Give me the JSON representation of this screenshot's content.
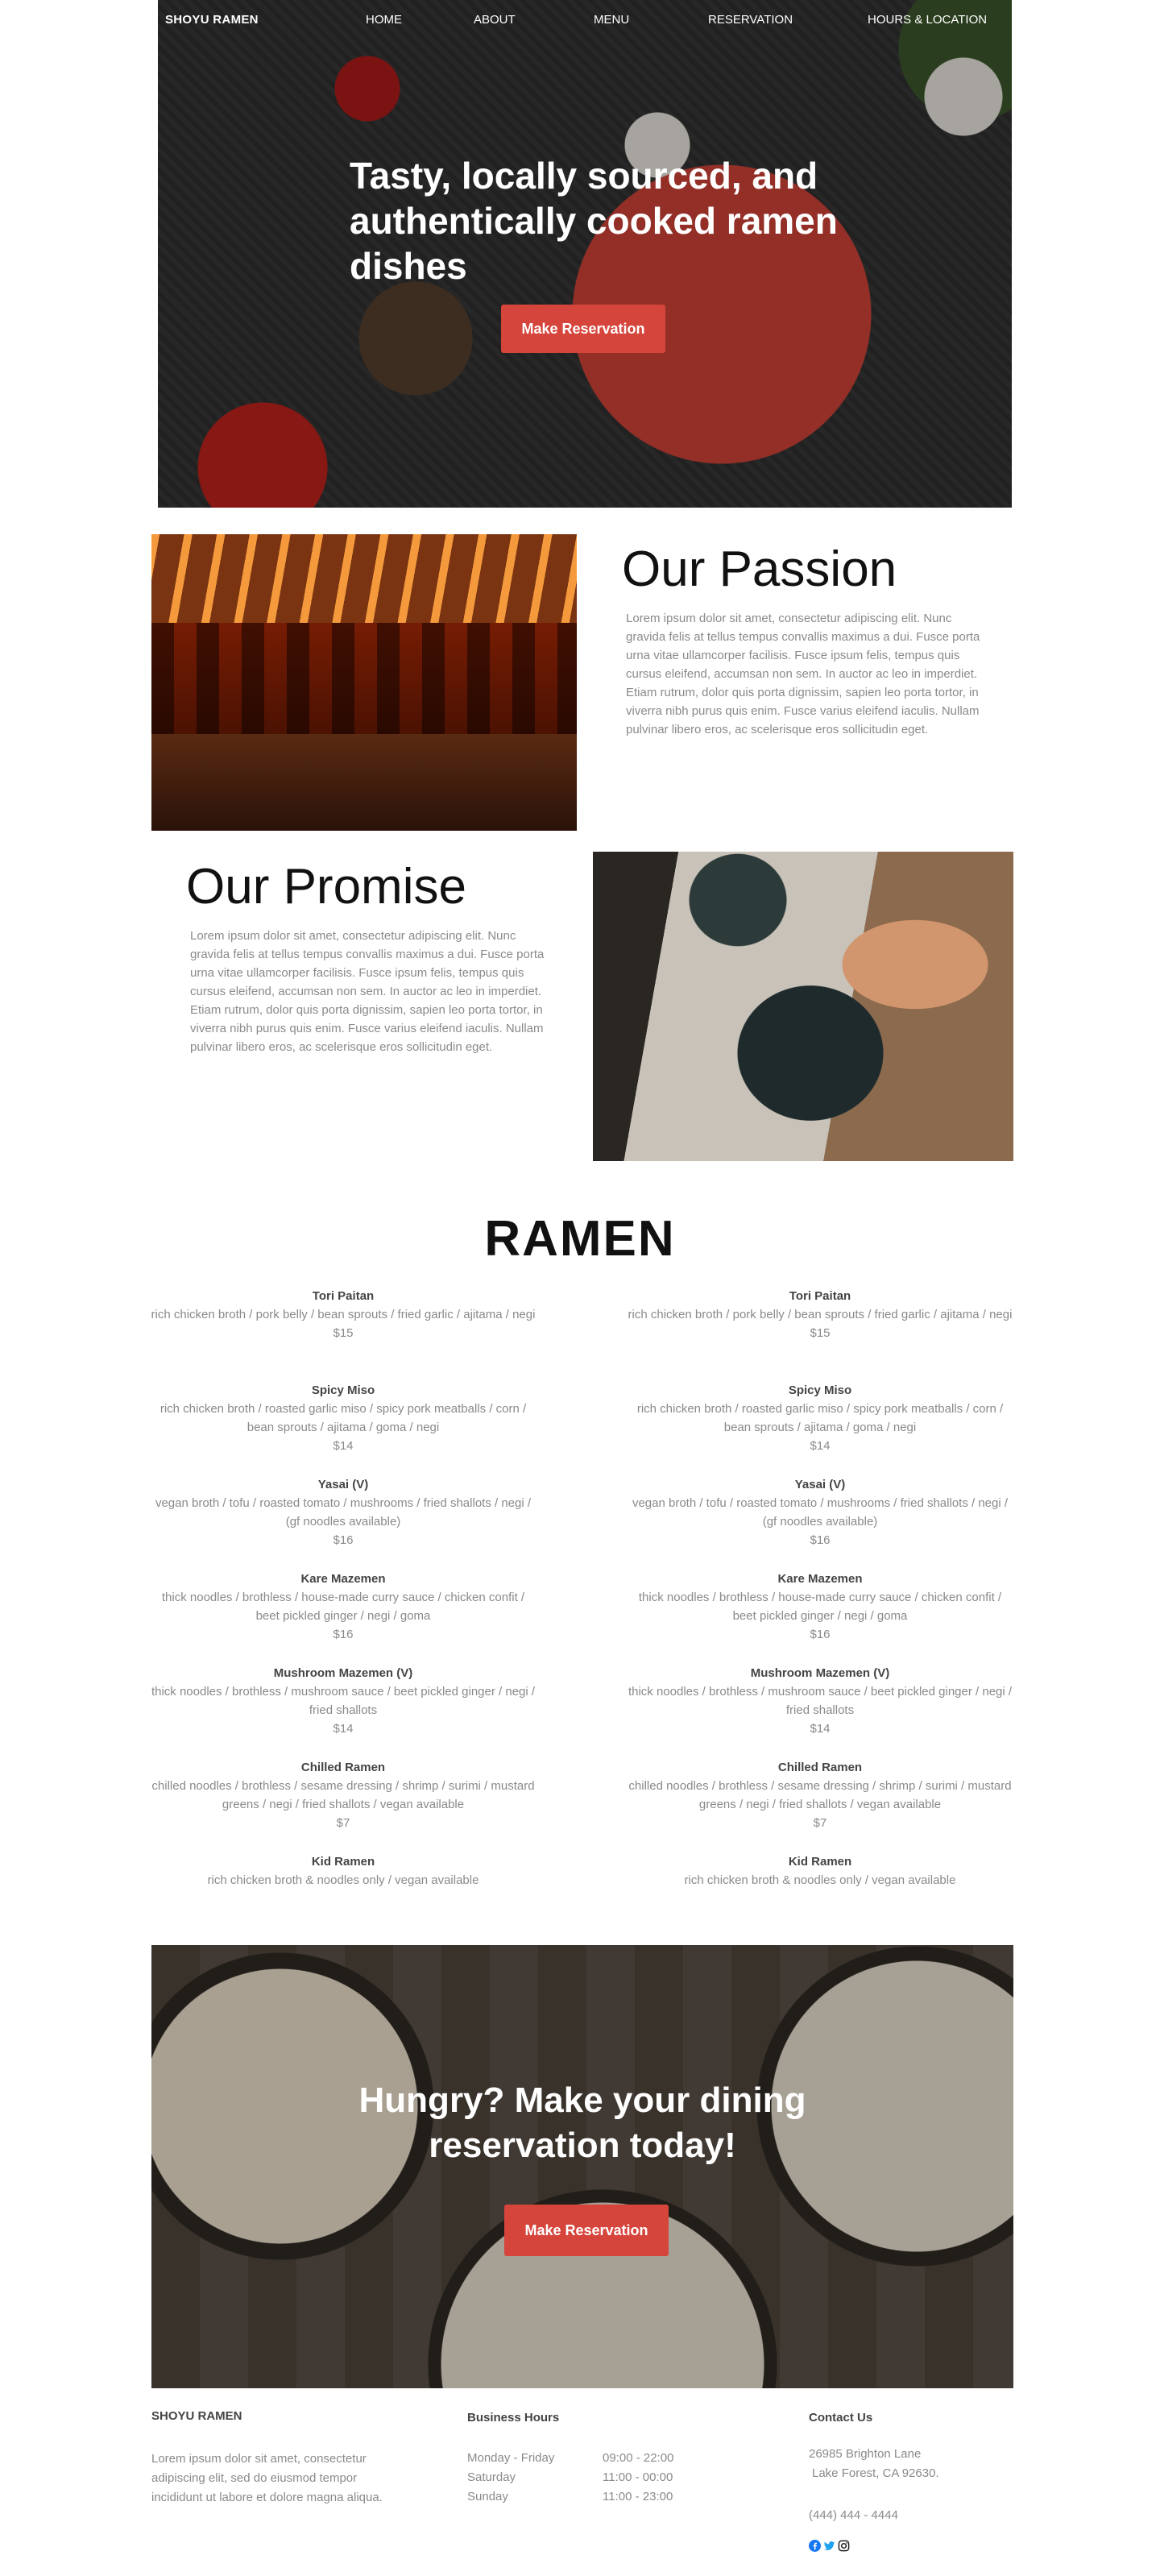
{
  "nav": {
    "brand": "SHOYU RAMEN",
    "links": [
      "HOME",
      "ABOUT",
      "MENU",
      "RESERVATION",
      "HOURS & LOCATION"
    ]
  },
  "hero": {
    "title": "Tasty, locally sourced, and authentically cooked ramen dishes",
    "button": "Make Reservation"
  },
  "passion": {
    "title": "Our Passion",
    "text": "Lorem ipsum dolor sit amet, consectetur adipiscing elit. Nunc gravida felis at tellus tempus convallis maximus a dui. Fusce porta urna vitae ullamcorper facilisis. Fusce ipsum felis, tempus quis cursus eleifend, accumsan non sem. In auctor ac leo in imperdiet. Etiam rutrum, dolor quis porta dignissim, sapien leo porta tortor, in viverra nibh purus quis enim. Fusce varius eleifend iaculis. Nullam pulvinar libero eros, ac scelerisque eros sollicitudin eget."
  },
  "promise": {
    "title": "Our Promise",
    "text": "Lorem ipsum dolor sit amet, consectetur adipiscing elit. Nunc gravida felis at tellus tempus convallis maximus a dui. Fusce porta urna vitae ullamcorper facilisis. Fusce ipsum felis, tempus quis cursus eleifend, accumsan non sem. In auctor ac leo in imperdiet. Etiam rutrum, dolor quis porta dignissim, sapien leo porta tortor, in viverra nibh purus quis enim. Fusce varius eleifend iaculis. Nullam pulvinar libero eros, ac scelerisque eros sollicitudin eget."
  },
  "menu": {
    "title": "RAMEN",
    "left": [
      {
        "name": "Tori Paitan",
        "desc": "rich chicken broth / pork belly / bean sprouts / fried garlic / ajitama / negi",
        "price": "$15"
      },
      {
        "name": "Spicy Miso",
        "desc": "rich chicken broth / roasted garlic miso / spicy pork meatballs / corn / bean sprouts / ajitama / goma / negi",
        "price": "$14"
      },
      {
        "name": "Yasai (V)",
        "desc": "vegan broth / tofu / roasted tomato / mushrooms / fried shallots / negi / (gf noodles available)",
        "price": "$16"
      },
      {
        "name": "Kare Mazemen",
        "desc": "thick noodles / brothless / house-made curry sauce / chicken confit / beet pickled ginger / negi / goma",
        "price": "$16"
      },
      {
        "name": "Mushroom Mazemen (V)",
        "desc": "thick noodles / brothless / mushroom sauce / beet pickled ginger / negi / fried shallots",
        "price": "$14"
      },
      {
        "name": "Chilled Ramen",
        "desc": "chilled noodles / brothless / sesame dressing / shrimp / surimi / mustard greens / negi / fried shallots / vegan available",
        "price": "$7"
      },
      {
        "name": "Kid Ramen",
        "desc": "rich chicken broth & noodles only / vegan available",
        "price": ""
      }
    ],
    "right": [
      {
        "name": "Tori Paitan",
        "desc": "rich chicken broth / pork belly / bean sprouts / fried garlic / ajitama / negi",
        "price": "$15"
      },
      {
        "name": "Spicy Miso",
        "desc": "rich chicken broth / roasted garlic miso / spicy pork meatballs / corn / bean sprouts / ajitama / goma / negi",
        "price": "$14"
      },
      {
        "name": "Yasai (V)",
        "desc": "vegan broth / tofu / roasted tomato / mushrooms / fried shallots / negi / (gf noodles available)",
        "price": "$16"
      },
      {
        "name": "Kare Mazemen",
        "desc": "thick noodles / brothless / house-made curry sauce / chicken confit / beet pickled ginger / negi / goma",
        "price": "$16"
      },
      {
        "name": "Mushroom Mazemen (V)",
        "desc": "thick noodles / brothless / mushroom sauce / beet pickled ginger / negi / fried shallots",
        "price": "$14"
      },
      {
        "name": "Chilled Ramen",
        "desc": "chilled noodles / brothless / sesame dressing / shrimp / surimi / mustard greens / negi / fried shallots / vegan available",
        "price": "$7"
      },
      {
        "name": "Kid Ramen",
        "desc": "rich chicken broth & noodles only / vegan available",
        "price": ""
      }
    ]
  },
  "cta": {
    "title": "Hungry? Make your dining reservation today!",
    "button": "Make Reservation"
  },
  "footer": {
    "brand": "SHOYU RAMEN",
    "about": "Lorem ipsum dolor sit amet, consectetur adipiscing elit, sed do eiusmod tempor incididunt ut labore et dolore magna aliqua.",
    "hours_title": "Business Hours",
    "hours": [
      {
        "day": "Monday - Friday",
        "time": "09:00 - 22:00"
      },
      {
        "day": "Saturday",
        "time": "11:00 - 00:00"
      },
      {
        "day": "Sunday",
        "time": "11:00 - 23:00"
      }
    ],
    "contact_title": "Contact Us",
    "address_line1": "26985 Brighton Lane",
    "address_line2": "Lake Forest, CA 92630.",
    "phone": "(444) 444 - 4444",
    "social_icons": [
      "facebook-icon",
      "twitter-icon",
      "instagram-icon"
    ]
  },
  "colors": {
    "accent": "#d6453c",
    "body_text": "#8a8a8a",
    "heading": "#111111",
    "facebook": "#1877f2",
    "twitter": "#1da1f2"
  }
}
